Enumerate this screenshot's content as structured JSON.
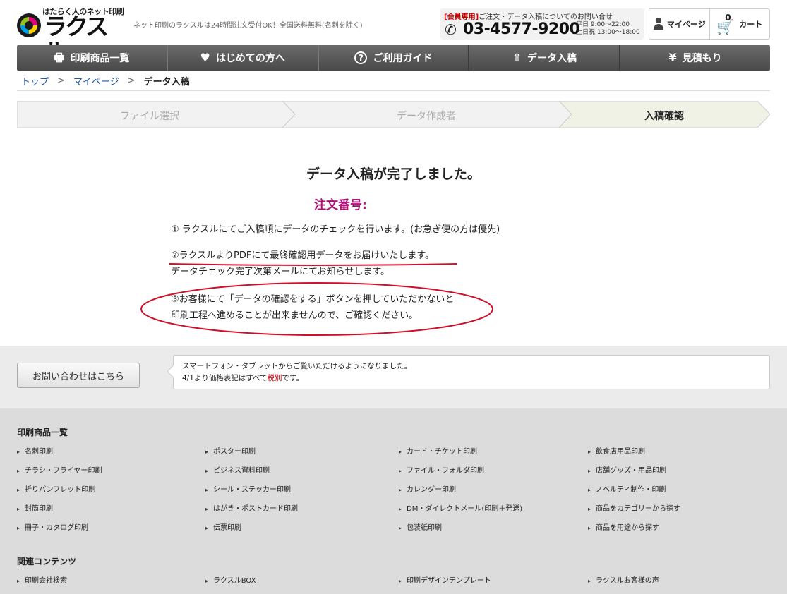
{
  "header": {
    "logo_tagline": "はたらく人のネット印刷",
    "logo_text": "ラクスル",
    "tagline": "ネット印刷のラクスルは24時間注文受付OK！全国送料無料(名刺を除く)",
    "member_label": "[会員専用]",
    "phone_note": "ご注文・データ入稿についてのお問い合せ",
    "phone_number": "03-4577-9200",
    "hours_weekday": "平日 9:00〜22:00",
    "hours_weekend": "土日祝 13:00〜18:00",
    "mypage_label": "マイページ",
    "cart_label": "カート",
    "cart_count": "0"
  },
  "nav": [
    {
      "label": "印刷商品一覧",
      "icon": "printer-icon"
    },
    {
      "label": "はじめての方へ",
      "icon": "heart-icon"
    },
    {
      "label": "ご利用ガイド",
      "icon": "question-icon"
    },
    {
      "label": "データ入稿",
      "icon": "upload-icon"
    },
    {
      "label": "見積もり",
      "icon": "yen-icon"
    }
  ],
  "breadcrumb": {
    "top": "トップ",
    "sep": ">",
    "mypage": "マイページ",
    "current": "データ入稿"
  },
  "steps": [
    {
      "label": "ファイル選択",
      "active": false
    },
    {
      "label": "データ作成者",
      "active": false
    },
    {
      "label": "入稿確認",
      "active": true
    }
  ],
  "main": {
    "title": "データ入稿が完了しました。",
    "order_label": "注文番号:",
    "line1": "① ラクスルにてご入稿順にデータのチェックを行います。(お急ぎ便の方は優先)",
    "line2a": "②ラクスルよりPDFにて最終確認用データをお届けいたします。",
    "line2b": "データチェック完了次第メールにてお知らせします。",
    "line3a": "③お客様にて「データの確認をする」ボタンを押していただかないと",
    "line3b": "印刷工程へ進めることが出来ませんので、ご確認ください。"
  },
  "info": {
    "contact_button": "お問い合わせはこちら",
    "notice_line1": "スマートフォン・タブレットからご覧いただけるようになりました。",
    "notice_line2_prefix": "4/1より価格表記はすべて",
    "notice_line2_link": "税別",
    "notice_line2_suffix": "です。"
  },
  "footer": {
    "products_heading": "印刷商品一覧",
    "products": [
      [
        "名刺印刷",
        "ポスター印刷",
        "カード・チケット印刷",
        "飲食店用品印刷"
      ],
      [
        "チラシ・フライヤー印刷",
        "ビジネス資料印刷",
        "ファイル・フォルダ印刷",
        "店舗グッズ・用品印刷"
      ],
      [
        "折りパンフレット印刷",
        "シール・ステッカー印刷",
        "カレンダー印刷",
        "ノベルティ制作・印刷"
      ],
      [
        "封筒印刷",
        "はがき・ポストカード印刷",
        "DM・ダイレクトメール(印刷＋発送)",
        "商品をカテゴリーから探す"
      ],
      [
        "冊子・カタログ印刷",
        "伝票印刷",
        "包装紙印刷",
        "商品を用途から探す"
      ]
    ],
    "related_heading": "関連コンテンツ",
    "related": [
      "印刷会社検索",
      "ラクスルBOX",
      "印刷デザインテンプレート",
      "ラクスルお客様の声"
    ]
  },
  "colors": {
    "accent_magenta": "#b0127a",
    "annotation_red": "#d0102a",
    "link_blue": "#1a5aa8",
    "nav_gray": "#555555",
    "active_step": "#f0f2e6"
  }
}
